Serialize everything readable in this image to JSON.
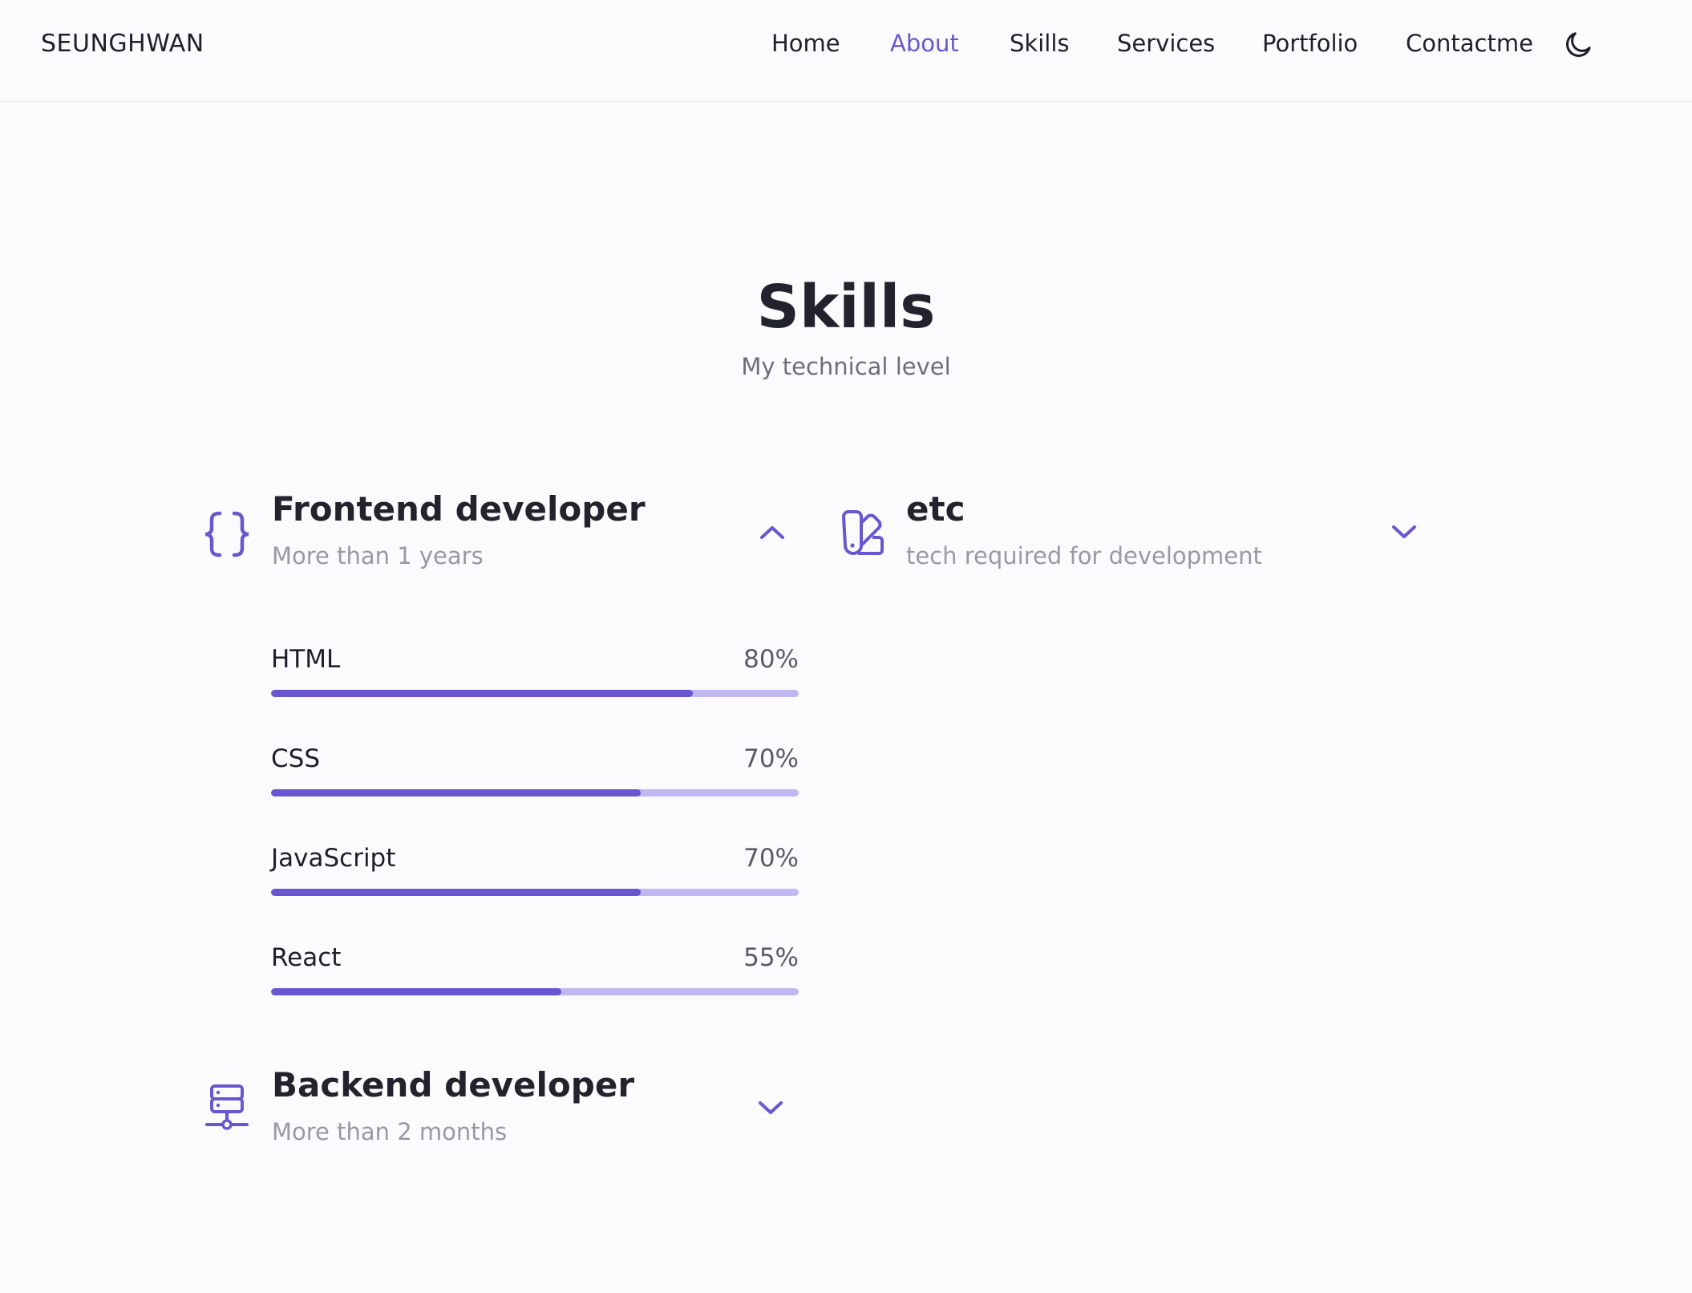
{
  "header": {
    "logo": "SEUNGHWAN",
    "nav": [
      {
        "label": "Home",
        "active": false
      },
      {
        "label": "About",
        "active": true
      },
      {
        "label": "Skills",
        "active": false
      },
      {
        "label": "Services",
        "active": false
      },
      {
        "label": "Portfolio",
        "active": false
      },
      {
        "label": "Contactme",
        "active": false
      }
    ],
    "theme_toggle_icon": "moon-icon"
  },
  "section": {
    "title": "Skills",
    "subtitle": "My technical level"
  },
  "groups": {
    "frontend": {
      "title": "Frontend developer",
      "subtitle": "More than 1 years",
      "icon": "braces-icon",
      "expanded": true,
      "skills": [
        {
          "name": "HTML",
          "percent_label": "80%",
          "percent": 80
        },
        {
          "name": "CSS",
          "percent_label": "70%",
          "percent": 70
        },
        {
          "name": "JavaScript",
          "percent_label": "70%",
          "percent": 70
        },
        {
          "name": "React",
          "percent_label": "55%",
          "percent": 55
        }
      ]
    },
    "backend": {
      "title": "Backend developer",
      "subtitle": "More than 2 months",
      "icon": "server-icon",
      "expanded": false
    },
    "etc": {
      "title": "etc",
      "subtitle": "tech required for development",
      "icon": "swatchbook-icon",
      "expanded": false
    }
  },
  "colors": {
    "accent": "#6b56d0",
    "bar_track": "#c2b7f1",
    "background": "#fbfbfd"
  }
}
